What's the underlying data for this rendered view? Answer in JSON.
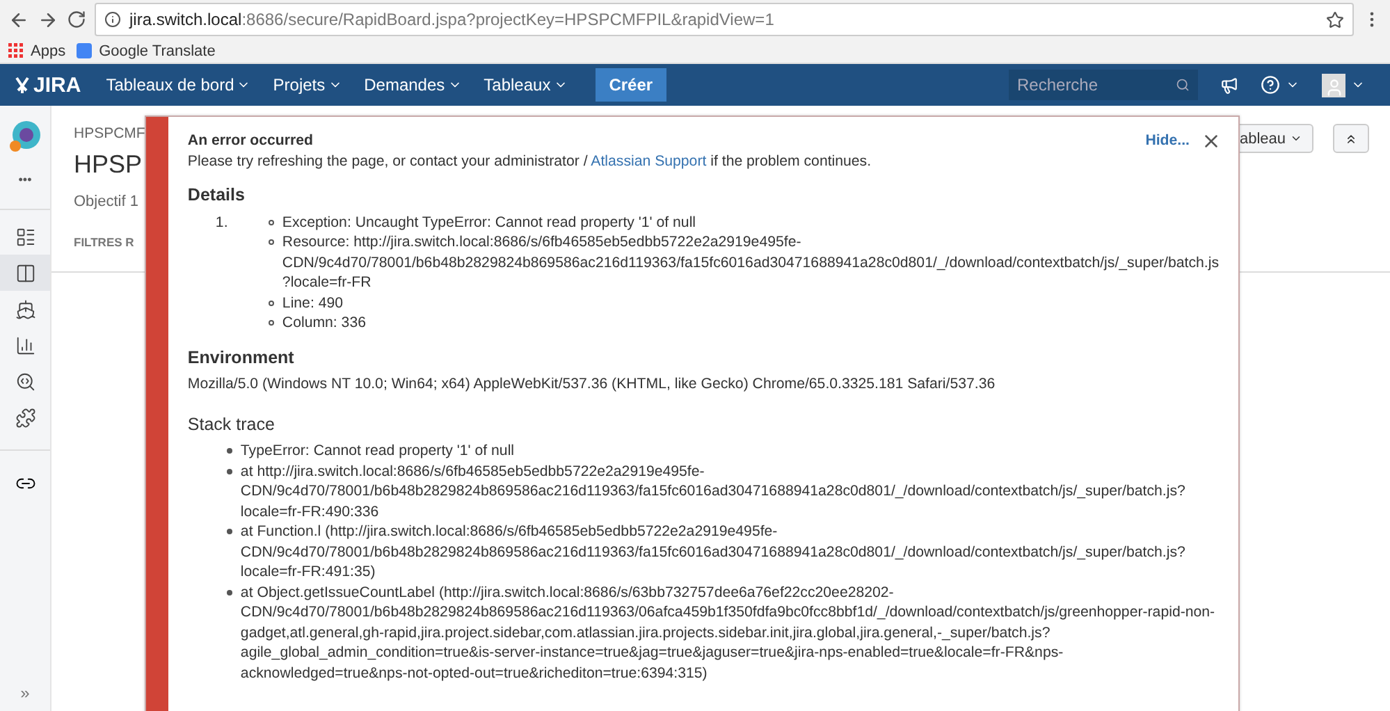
{
  "browser": {
    "url_host": "jira.switch.local",
    "url_rest": ":8686/secure/RapidBoard.jspa?projectKey=HPSPCMFPIL&rapidView=1",
    "bookmarks": [
      "Apps",
      "Google Translate"
    ]
  },
  "nav": {
    "logo": "JIRA",
    "menus": [
      "Tableaux de bord",
      "Projets",
      "Demandes",
      "Tableaux"
    ],
    "create": "Créer",
    "search": {
      "placeholder": "Recherche"
    }
  },
  "sidebar": {
    "items": [
      {
        "selected": false
      },
      {
        "selected": true
      },
      {
        "selected": false
      },
      {
        "selected": false
      },
      {
        "selected": false
      },
      {
        "selected": false
      }
    ],
    "more": "•••",
    "collapse": "»"
  },
  "project": {
    "key": "HPSPCMF",
    "title": "HPSP",
    "subtitle": "Objectif 1",
    "filters": "FILTRES R",
    "board_button": "ableau"
  },
  "error": {
    "title": "An error occurred",
    "message_before": "Please try refreshing the page, or contact your administrator / ",
    "message_link": "Atlassian Support",
    "message_after": " if the problem continues.",
    "hide": "Hide...",
    "details_heading": "Details",
    "details_number": "1.",
    "details": [
      {
        "lines": [
          "Exception: Uncaught TypeError: Cannot read property '1' of null"
        ]
      },
      {
        "lines": [
          "Resource: http://jira.switch.local:8686/s/6fb46585eb5edbb5722e2a2919e495fe-",
          "CDN/9c4d70/78001/b6b48b2829824b869586ac216d119363/fa15fc6016ad30471688941a28c0d801/_/download/contextbatch/js/_super/batch.js",
          "?locale=fr-FR"
        ]
      },
      {
        "lines": [
          "Line: 490"
        ]
      },
      {
        "lines": [
          "Column: 336"
        ]
      }
    ],
    "environment_heading": "Environment",
    "environment": "Mozilla/5.0 (Windows NT 10.0; Win64; x64) AppleWebKit/537.36 (KHTML, like Gecko) Chrome/65.0.3325.181 Safari/537.36",
    "stack_heading": "Stack trace",
    "stack": [
      {
        "lines": [
          "TypeError: Cannot read property '1' of null"
        ]
      },
      {
        "lines": [
          "at http://jira.switch.local:8686/s/6fb46585eb5edbb5722e2a2919e495fe-",
          "CDN/9c4d70/78001/b6b48b2829824b869586ac216d119363/fa15fc6016ad30471688941a28c0d801/_/download/contextbatch/js/_super/batch.js?",
          "locale=fr-FR:490:336"
        ]
      },
      {
        "lines": [
          "at Function.l (http://jira.switch.local:8686/s/6fb46585eb5edbb5722e2a2919e495fe-",
          "CDN/9c4d70/78001/b6b48b2829824b869586ac216d119363/fa15fc6016ad30471688941a28c0d801/_/download/contextbatch/js/_super/batch.js?",
          "locale=fr-FR:491:35)"
        ]
      },
      {
        "lines": [
          "at Object.getIssueCountLabel (http://jira.switch.local:8686/s/63bb732757dee6a76ef22cc20ee28202-",
          "CDN/9c4d70/78001/b6b48b2829824b869586ac216d119363/06afca459b1f350fdfa9bc0fcc8bbf1d/_/download/contextbatch/js/greenhopper-rapid-non-",
          "gadget,atl.general,gh-rapid,jira.project.sidebar,com.atlassian.jira.projects.sidebar.init,jira.global,jira.general,-_super/batch.js?",
          "agile_global_admin_condition=true&is-server-instance=true&jag=true&jaguser=true&jira-nps-enabled=true&locale=fr-FR&nps-",
          "acknowledged=true&nps-not-opted-out=true&richediton=true:6394:315)"
        ]
      }
    ]
  }
}
